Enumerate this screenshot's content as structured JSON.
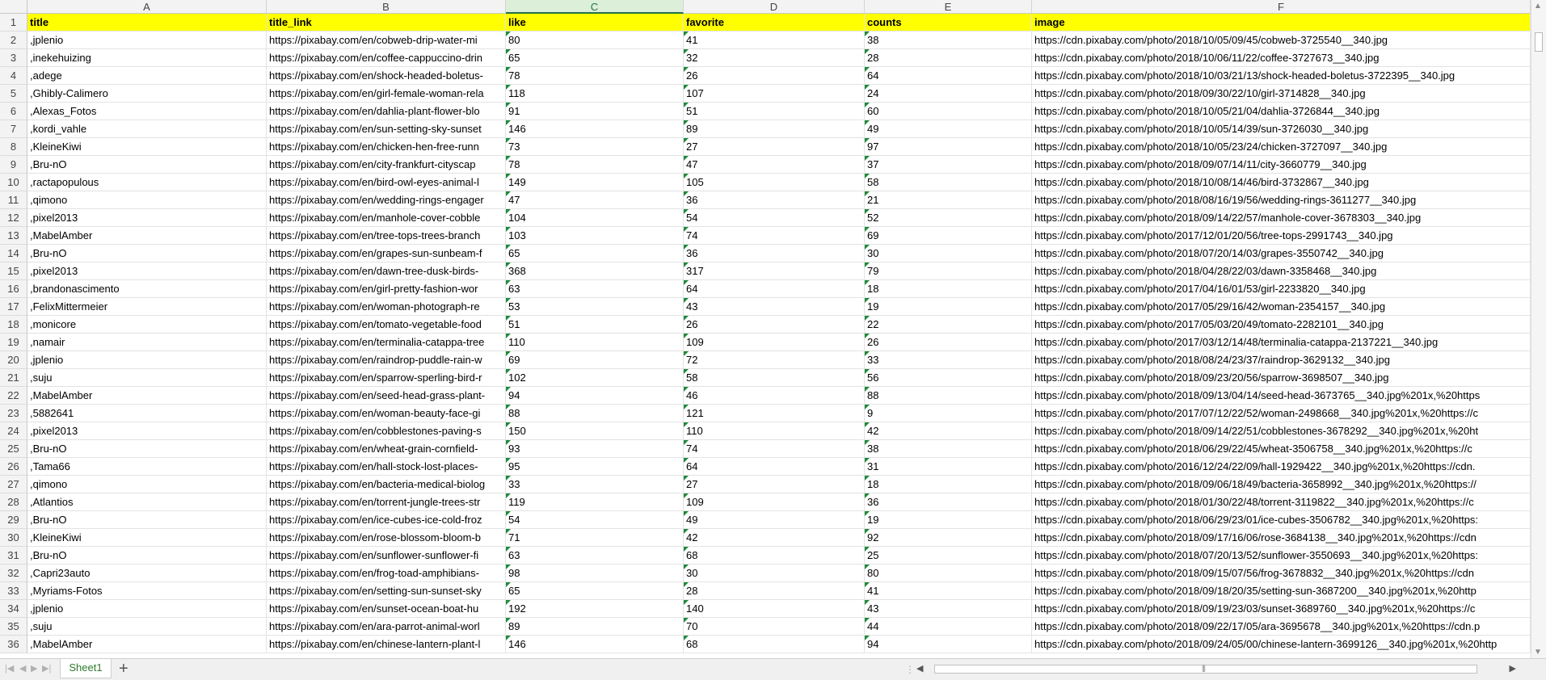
{
  "column_headers": [
    "A",
    "B",
    "C",
    "D",
    "E",
    "F"
  ],
  "selected_column": "C",
  "header_row": [
    "title",
    "title_link",
    "like",
    "favorite",
    "counts",
    "image"
  ],
  "rows": [
    [
      ",jplenio",
      "https://pixabay.com/en/cobweb-drip-water-mi",
      "80",
      "41",
      "38",
      "https://cdn.pixabay.com/photo/2018/10/05/09/45/cobweb-3725540__340.jpg"
    ],
    [
      ",inekehuizing",
      "https://pixabay.com/en/coffee-cappuccino-drin",
      "65",
      "32",
      "28",
      "https://cdn.pixabay.com/photo/2018/10/06/11/22/coffee-3727673__340.jpg"
    ],
    [
      ",adege",
      "https://pixabay.com/en/shock-headed-boletus-",
      "78",
      "26",
      "64",
      "https://cdn.pixabay.com/photo/2018/10/03/21/13/shock-headed-boletus-3722395__340.jpg"
    ],
    [
      ",Ghibly-Calimero",
      "https://pixabay.com/en/girl-female-woman-rela",
      "118",
      "107",
      "24",
      "https://cdn.pixabay.com/photo/2018/09/30/22/10/girl-3714828__340.jpg"
    ],
    [
      ",Alexas_Fotos",
      "https://pixabay.com/en/dahlia-plant-flower-blo",
      "91",
      "51",
      "60",
      "https://cdn.pixabay.com/photo/2018/10/05/21/04/dahlia-3726844__340.jpg"
    ],
    [
      ",kordi_vahle",
      "https://pixabay.com/en/sun-setting-sky-sunset",
      "146",
      "89",
      "49",
      "https://cdn.pixabay.com/photo/2018/10/05/14/39/sun-3726030__340.jpg"
    ],
    [
      ",KleineKiwi",
      "https://pixabay.com/en/chicken-hen-free-runn",
      "73",
      "27",
      "97",
      "https://cdn.pixabay.com/photo/2018/10/05/23/24/chicken-3727097__340.jpg"
    ],
    [
      ",Bru-nO",
      "https://pixabay.com/en/city-frankfurt-cityscap",
      "78",
      "47",
      "37",
      "https://cdn.pixabay.com/photo/2018/09/07/14/11/city-3660779__340.jpg"
    ],
    [
      ",ractapopulous",
      "https://pixabay.com/en/bird-owl-eyes-animal-l",
      "149",
      "105",
      "58",
      "https://cdn.pixabay.com/photo/2018/10/08/14/46/bird-3732867__340.jpg"
    ],
    [
      ",qimono",
      "https://pixabay.com/en/wedding-rings-engager",
      "47",
      "36",
      "21",
      "https://cdn.pixabay.com/photo/2018/08/16/19/56/wedding-rings-3611277__340.jpg"
    ],
    [
      ",pixel2013",
      "https://pixabay.com/en/manhole-cover-cobble",
      "104",
      "54",
      "52",
      "https://cdn.pixabay.com/photo/2018/09/14/22/57/manhole-cover-3678303__340.jpg"
    ],
    [
      ",MabelAmber",
      "https://pixabay.com/en/tree-tops-trees-branch",
      "103",
      "74",
      "69",
      "https://cdn.pixabay.com/photo/2017/12/01/20/56/tree-tops-2991743__340.jpg"
    ],
    [
      ",Bru-nO",
      "https://pixabay.com/en/grapes-sun-sunbeam-f",
      "65",
      "36",
      "30",
      "https://cdn.pixabay.com/photo/2018/07/20/14/03/grapes-3550742__340.jpg"
    ],
    [
      ",pixel2013",
      "https://pixabay.com/en/dawn-tree-dusk-birds-",
      "368",
      "317",
      "79",
      "https://cdn.pixabay.com/photo/2018/04/28/22/03/dawn-3358468__340.jpg"
    ],
    [
      ",brandonascimento",
      "https://pixabay.com/en/girl-pretty-fashion-wor",
      "63",
      "64",
      "18",
      "https://cdn.pixabay.com/photo/2017/04/16/01/53/girl-2233820__340.jpg"
    ],
    [
      ",FelixMittermeier",
      "https://pixabay.com/en/woman-photograph-re",
      "53",
      "43",
      "19",
      "https://cdn.pixabay.com/photo/2017/05/29/16/42/woman-2354157__340.jpg"
    ],
    [
      ",monicore",
      "https://pixabay.com/en/tomato-vegetable-food",
      "51",
      "26",
      "22",
      "https://cdn.pixabay.com/photo/2017/05/03/20/49/tomato-2282101__340.jpg"
    ],
    [
      ",namair",
      "https://pixabay.com/en/terminalia-catappa-tree",
      "110",
      "109",
      "26",
      "https://cdn.pixabay.com/photo/2017/03/12/14/48/terminalia-catappa-2137221__340.jpg"
    ],
    [
      ",jplenio",
      "https://pixabay.com/en/raindrop-puddle-rain-w",
      "69",
      "72",
      "33",
      "https://cdn.pixabay.com/photo/2018/08/24/23/37/raindrop-3629132__340.jpg"
    ],
    [
      ",suju",
      "https://pixabay.com/en/sparrow-sperling-bird-r",
      "102",
      "58",
      "56",
      "https://cdn.pixabay.com/photo/2018/09/23/20/56/sparrow-3698507__340.jpg"
    ],
    [
      ",MabelAmber",
      "https://pixabay.com/en/seed-head-grass-plant-",
      "94",
      "46",
      "88",
      "https://cdn.pixabay.com/photo/2018/09/13/04/14/seed-head-3673765__340.jpg%201x,%20https"
    ],
    [
      ",5882641",
      "https://pixabay.com/en/woman-beauty-face-gi",
      "88",
      "121",
      "9",
      "https://cdn.pixabay.com/photo/2017/07/12/22/52/woman-2498668__340.jpg%201x,%20https://c"
    ],
    [
      ",pixel2013",
      "https://pixabay.com/en/cobblestones-paving-s",
      "150",
      "110",
      "42",
      "https://cdn.pixabay.com/photo/2018/09/14/22/51/cobblestones-3678292__340.jpg%201x,%20ht"
    ],
    [
      ",Bru-nO",
      "https://pixabay.com/en/wheat-grain-cornfield-",
      "93",
      "74",
      "38",
      "https://cdn.pixabay.com/photo/2018/06/29/22/45/wheat-3506758__340.jpg%201x,%20https://c"
    ],
    [
      ",Tama66",
      "https://pixabay.com/en/hall-stock-lost-places-",
      "95",
      "64",
      "31",
      "https://cdn.pixabay.com/photo/2016/12/24/22/09/hall-1929422__340.jpg%201x,%20https://cdn."
    ],
    [
      ",qimono",
      "https://pixabay.com/en/bacteria-medical-biolog",
      "33",
      "27",
      "18",
      "https://cdn.pixabay.com/photo/2018/09/06/18/49/bacteria-3658992__340.jpg%201x,%20https://"
    ],
    [
      ",Atlantios",
      "https://pixabay.com/en/torrent-jungle-trees-str",
      "119",
      "109",
      "36",
      "https://cdn.pixabay.com/photo/2018/01/30/22/48/torrent-3119822__340.jpg%201x,%20https://c"
    ],
    [
      ",Bru-nO",
      "https://pixabay.com/en/ice-cubes-ice-cold-froz",
      "54",
      "49",
      "19",
      "https://cdn.pixabay.com/photo/2018/06/29/23/01/ice-cubes-3506782__340.jpg%201x,%20https:"
    ],
    [
      ",KleineKiwi",
      "https://pixabay.com/en/rose-blossom-bloom-b",
      "71",
      "42",
      "92",
      "https://cdn.pixabay.com/photo/2018/09/17/16/06/rose-3684138__340.jpg%201x,%20https://cdn"
    ],
    [
      ",Bru-nO",
      "https://pixabay.com/en/sunflower-sunflower-fi",
      "63",
      "68",
      "25",
      "https://cdn.pixabay.com/photo/2018/07/20/13/52/sunflower-3550693__340.jpg%201x,%20https:"
    ],
    [
      ",Capri23auto",
      "https://pixabay.com/en/frog-toad-amphibians-",
      "98",
      "30",
      "80",
      "https://cdn.pixabay.com/photo/2018/09/15/07/56/frog-3678832__340.jpg%201x,%20https://cdn"
    ],
    [
      ",Myriams-Fotos",
      "https://pixabay.com/en/setting-sun-sunset-sky",
      "65",
      "28",
      "41",
      "https://cdn.pixabay.com/photo/2018/09/18/20/35/setting-sun-3687200__340.jpg%201x,%20http"
    ],
    [
      ",jplenio",
      "https://pixabay.com/en/sunset-ocean-boat-hu",
      "192",
      "140",
      "43",
      "https://cdn.pixabay.com/photo/2018/09/19/23/03/sunset-3689760__340.jpg%201x,%20https://c"
    ],
    [
      ",suju",
      "https://pixabay.com/en/ara-parrot-animal-worl",
      "89",
      "70",
      "44",
      "https://cdn.pixabay.com/photo/2018/09/22/17/05/ara-3695678__340.jpg%201x,%20https://cdn.p"
    ],
    [
      ",MabelAmber",
      "https://pixabay.com/en/chinese-lantern-plant-l",
      "146",
      "68",
      "94",
      "https://cdn.pixabay.com/photo/2018/09/24/05/00/chinese-lantern-3699126__340.jpg%201x,%20http"
    ]
  ],
  "sheet_tabs": [
    "Sheet1"
  ],
  "add_tab_label": "+",
  "nav_buttons": [
    "|◀",
    "◀",
    "▶",
    "▶|"
  ],
  "accent_color": "#217346",
  "header_fill_color": "#ffff00"
}
